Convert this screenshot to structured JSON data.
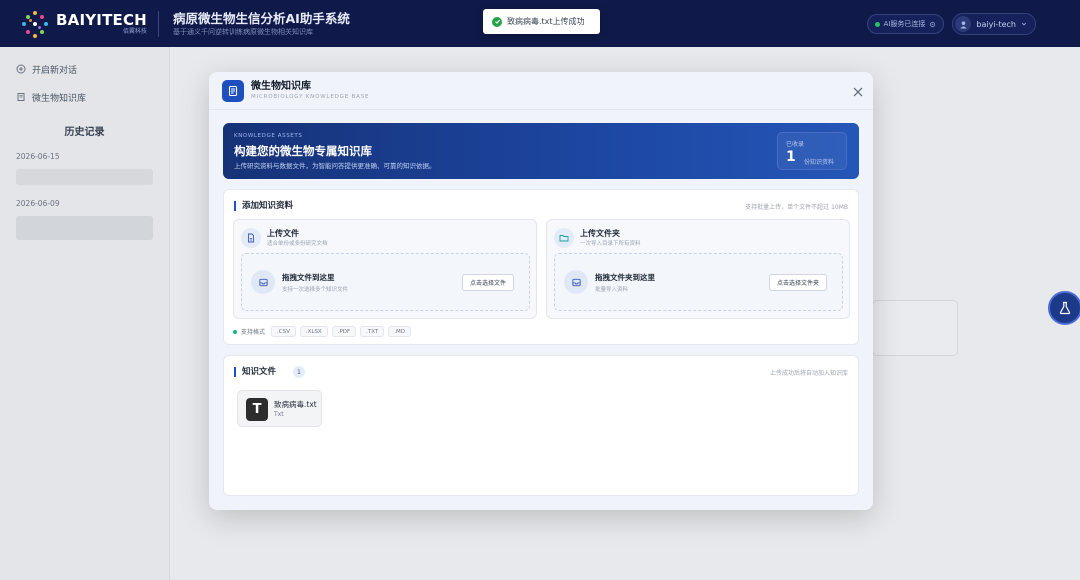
{
  "header": {
    "logo_title": "BAIYITECH",
    "logo_sub": "佰翼科技",
    "app_title": "病原微生物生信分析AI助手系统",
    "app_subtitle": "基于通义千问逆转训练病原微生物相关知识库",
    "ai_status": "AI服务已连接",
    "username": "baiyi-tech"
  },
  "toast": {
    "message": "致病病毒.txt上传成功"
  },
  "sidebar": {
    "items": [
      {
        "label": "开启新对话",
        "icon": "plus-circle-icon"
      },
      {
        "label": "微生物知识库",
        "icon": "book-icon"
      }
    ],
    "history_title": "历史记录",
    "history_dates": [
      "2026-06-15",
      "2026-06-09"
    ]
  },
  "modal": {
    "title": "微生物知识库",
    "subtitle": "MICROBIOLOGY KNOWLEDGE BASE",
    "banner": {
      "tag": "KNOWLEDGE ASSETS",
      "title": "构建您的微生物专属知识库",
      "description": "上传研究资料与数据文件，为智能问答提供更准确、可靠的知识依据。",
      "stat_label": "已收录",
      "stat_value": "1",
      "stat_unit": "份知识资料"
    },
    "add_section": {
      "title": "添加知识资料",
      "hint": "支持批量上传，单个文件不超过 10MB",
      "upload_file": {
        "title": "上传文件",
        "desc": "适合单份或多份研究文档",
        "drop_title": "拖拽文件到这里",
        "drop_desc": "支持一次选择多个知识文件",
        "button": "点击选择文件"
      },
      "upload_folder": {
        "title": "上传文件夹",
        "desc": "一次导入目录下所有资料",
        "drop_title": "拖拽文件夹到这里",
        "drop_desc": "批量导入资料",
        "button": "点击选择文件夹"
      },
      "formats_label": "支持格式",
      "formats": [
        ".CSV",
        ".XLSX",
        ".PDF",
        ".TXT",
        ".MD"
      ]
    },
    "files_section": {
      "title": "知识文件",
      "count": "1",
      "hint": "上传成功后将自动加入知识库",
      "files": [
        {
          "name": "致病病毒.txt",
          "type": "Txt",
          "icon_letter": "T"
        }
      ]
    }
  },
  "colors": {
    "header_bg": "#0f1a4a",
    "accent": "#1d4ed8",
    "banner_start": "#163277",
    "banner_end": "#2456b8",
    "success": "#22a34a"
  }
}
